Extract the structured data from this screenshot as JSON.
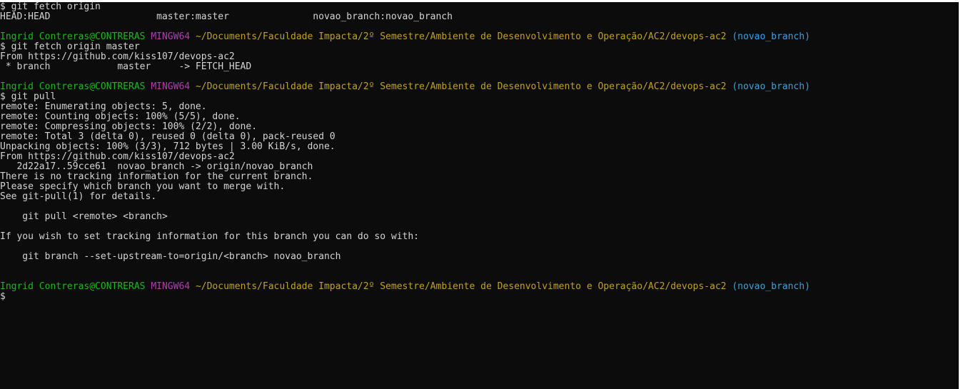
{
  "terminal": {
    "prompt": {
      "user": "Ingrid Contreras@CONTRERAS",
      "system": "MINGW64",
      "path": "~/Documents/Faculdade Impacta/2º Semestre/Ambiente de Desenvolvimento e Operação/AC2/devops-ac2",
      "branch": "(novao_branch)",
      "symbol": "$"
    },
    "blocks": [
      {
        "type": "output",
        "lines": [
          "$ git fetch origin",
          "HEAD:HEAD                   master:master               novao_branch:novao_branch"
        ]
      },
      {
        "type": "blank"
      },
      {
        "type": "prompt_block",
        "lines": [
          "$ git fetch origin master",
          "From https://github.com/kiss107/devops-ac2",
          " * branch            master     -> FETCH_HEAD"
        ]
      },
      {
        "type": "blank"
      },
      {
        "type": "prompt_block",
        "lines": [
          "$ git pull",
          "remote: Enumerating objects: 5, done.",
          "remote: Counting objects: 100% (5/5), done.",
          "remote: Compressing objects: 100% (2/2), done.",
          "remote: Total 3 (delta 0), reused 0 (delta 0), pack-reused 0",
          "Unpacking objects: 100% (3/3), 712 bytes | 3.00 KiB/s, done.",
          "From https://github.com/kiss107/devops-ac2",
          "   2d22a17..59cce61  novao_branch -> origin/novao_branch",
          "There is no tracking information for the current branch.",
          "Please specify which branch you want to merge with.",
          "See git-pull(1) for details.",
          "",
          "    git pull <remote> <branch>",
          "",
          "If you wish to set tracking information for this branch you can do so with:",
          "",
          "    git branch --set-upstream-to=origin/<branch> novao_branch",
          "",
          ""
        ]
      },
      {
        "type": "prompt_block",
        "lines": [
          "$"
        ]
      }
    ]
  }
}
